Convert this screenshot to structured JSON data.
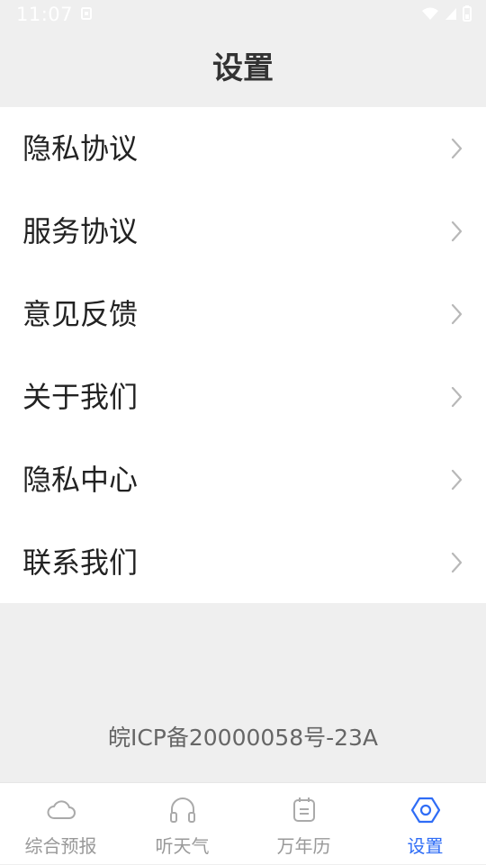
{
  "status_bar": {
    "time": "11:07"
  },
  "header": {
    "title": "设置"
  },
  "menu": {
    "items": [
      {
        "label": "隐私协议"
      },
      {
        "label": "服务协议"
      },
      {
        "label": "意见反馈"
      },
      {
        "label": "关于我们"
      },
      {
        "label": "隐私中心"
      },
      {
        "label": "联系我们"
      }
    ]
  },
  "footer": {
    "icp": "皖ICP备20000058号-23A"
  },
  "tabbar": {
    "tabs": [
      {
        "label": "综合预报",
        "icon": "cloud-icon",
        "active": false
      },
      {
        "label": "听天气",
        "icon": "headphones-icon",
        "active": false
      },
      {
        "label": "万年历",
        "icon": "calendar-icon",
        "active": false
      },
      {
        "label": "设置",
        "icon": "settings-hexagon-icon",
        "active": true
      }
    ],
    "active_color": "#2f6df6",
    "inactive_color": "#999999"
  }
}
